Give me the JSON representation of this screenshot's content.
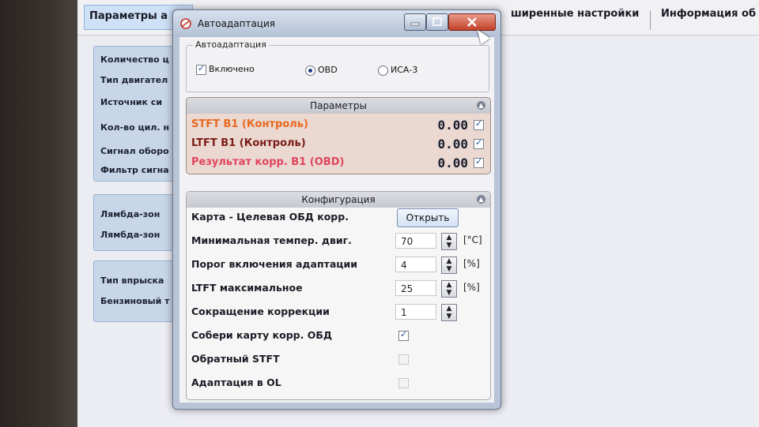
{
  "background_app": {
    "tabs": [
      "Параметры а",
      "ширенные настройки",
      "Информация об"
    ],
    "panel1_rows": [
      "Количество ц",
      "Тип двигател",
      "Источник си",
      "Кол-во цил. н",
      "Сигнал оборо",
      "Фильтр сигна"
    ],
    "panel2_rows": [
      "Лямбда-зон",
      "Лямбда-зон"
    ],
    "panel3_rows": [
      "Тип впрыска",
      "Бензиновый т"
    ]
  },
  "dialog": {
    "title": "Автоадаптация",
    "group_title": "Автоадаптация",
    "enabled_label": "Включено",
    "enabled_checked": true,
    "radio_obd": "OBD",
    "radio_isa": "ИСА-3",
    "selected_mode": "OBD"
  },
  "params": {
    "title": "Параметры",
    "rows": [
      {
        "label": "STFT B1 (Контроль)",
        "value": "0.00",
        "color": "#e8681f",
        "checked": true
      },
      {
        "label": "LTFT B1 (Контроль)",
        "value": "0.00",
        "color": "#7a1d16",
        "checked": true
      },
      {
        "label": "Результат корр. B1 (OBD)",
        "value": "0.00",
        "color": "#e0455e",
        "checked": true
      }
    ]
  },
  "config": {
    "title": "Конфигурация",
    "map_label": "Карта - Целевая ОБД корр.",
    "open_button": "Открыть",
    "rows": [
      {
        "label": "Минимальная темпер. двиг.",
        "value": "70",
        "unit": "[°C]"
      },
      {
        "label": "Порог включения адаптации",
        "value": "4",
        "unit": "[%]"
      },
      {
        "label": "LTFT максимальное",
        "value": "25",
        "unit": "[%]"
      },
      {
        "label": "Сокращение коррекции",
        "value": "1",
        "unit": ""
      }
    ],
    "checks": [
      {
        "label": "Собери карту корр. ОБД",
        "checked": true
      },
      {
        "label": "Обратный STFT",
        "checked": false
      },
      {
        "label": "Адаптация в OL",
        "checked": false
      }
    ]
  }
}
